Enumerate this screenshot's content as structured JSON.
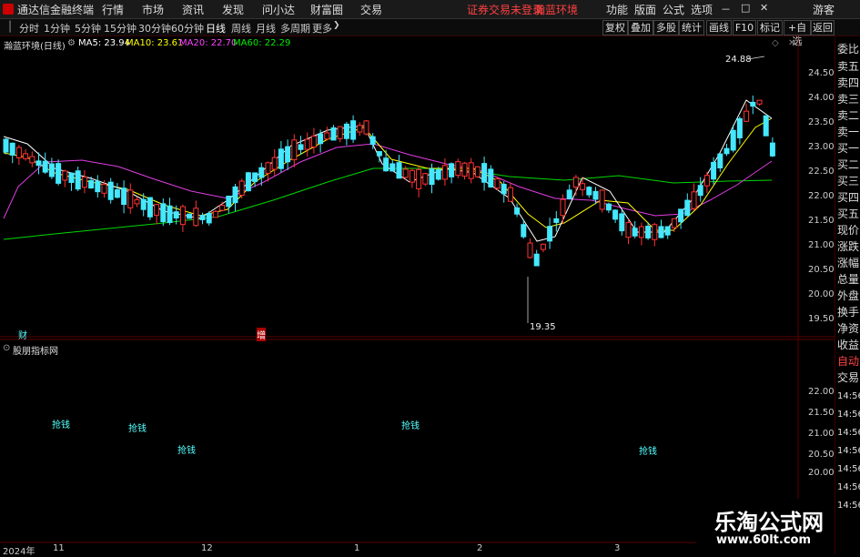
{
  "menubar": {
    "app_title": "通达信金融终端",
    "menus": [
      "行情",
      "市场",
      "资讯",
      "发现",
      "问小达",
      "财富圈",
      "交易"
    ],
    "warning": "证券交易未登录",
    "stock_name": "瀚蓝环境",
    "right_items": [
      "功能",
      "版面",
      "公式",
      "选项"
    ],
    "user": "游客"
  },
  "periodbar": {
    "periods": [
      "分时",
      "1分钟",
      "5分钟",
      "15分钟",
      "30分钟",
      "60分钟",
      "日线",
      "周线",
      "月线",
      "多周期",
      "更多"
    ],
    "active": "日线",
    "tools": [
      "复权",
      "叠加",
      "多股",
      "统计",
      "画线",
      "F10",
      "标记",
      "+自选",
      "返回"
    ]
  },
  "chart_header": {
    "title": "瀚蓝环境(日线)",
    "ma5": "MA5: 23.94",
    "ma10": "MA10: 23.61",
    "ma20": "MA20: 22.70",
    "ma60": "MA60: 22.29",
    "colors": {
      "ma5": "#ffffff",
      "ma10": "#ffff00",
      "ma20": "#ff44ff",
      "ma60": "#00e000",
      "up": "#ff3333",
      "down": "#44e8ff"
    }
  },
  "price_axis": [
    "24.50",
    "24.00",
    "23.50",
    "23.00",
    "22.50",
    "22.00",
    "21.50",
    "21.00",
    "20.50",
    "20.00",
    "19.50"
  ],
  "high_label": "24.88",
  "low_label": "19.35",
  "event_marks": [
    "财",
    "增"
  ],
  "indicator": {
    "title": "股朋指标网",
    "axis": [
      "22.00",
      "21.50",
      "21.00",
      "20.50",
      "20.00"
    ],
    "signals": [
      "抢钱",
      "抢钱",
      "抢钱",
      "抢钱",
      "抢钱"
    ]
  },
  "date_axis": [
    "2024年",
    "11",
    "12",
    "1",
    "2",
    "3"
  ],
  "right_panel": {
    "items": [
      "委比",
      "卖五",
      "卖四",
      "卖三",
      "卖二",
      "卖一",
      "买一",
      "买二",
      "买三",
      "买四",
      "买五",
      "现价",
      "涨跌",
      "涨幅",
      "总量",
      "外盘",
      "换手",
      "净资",
      "收益",
      "自动",
      "交易"
    ],
    "times": [
      "14:56",
      "14:56",
      "14:56",
      "14:56",
      "14:56",
      "14:56",
      "14:56"
    ]
  },
  "watermark": {
    "name": "乐淘公式网",
    "url": "www.60lt.com"
  }
}
